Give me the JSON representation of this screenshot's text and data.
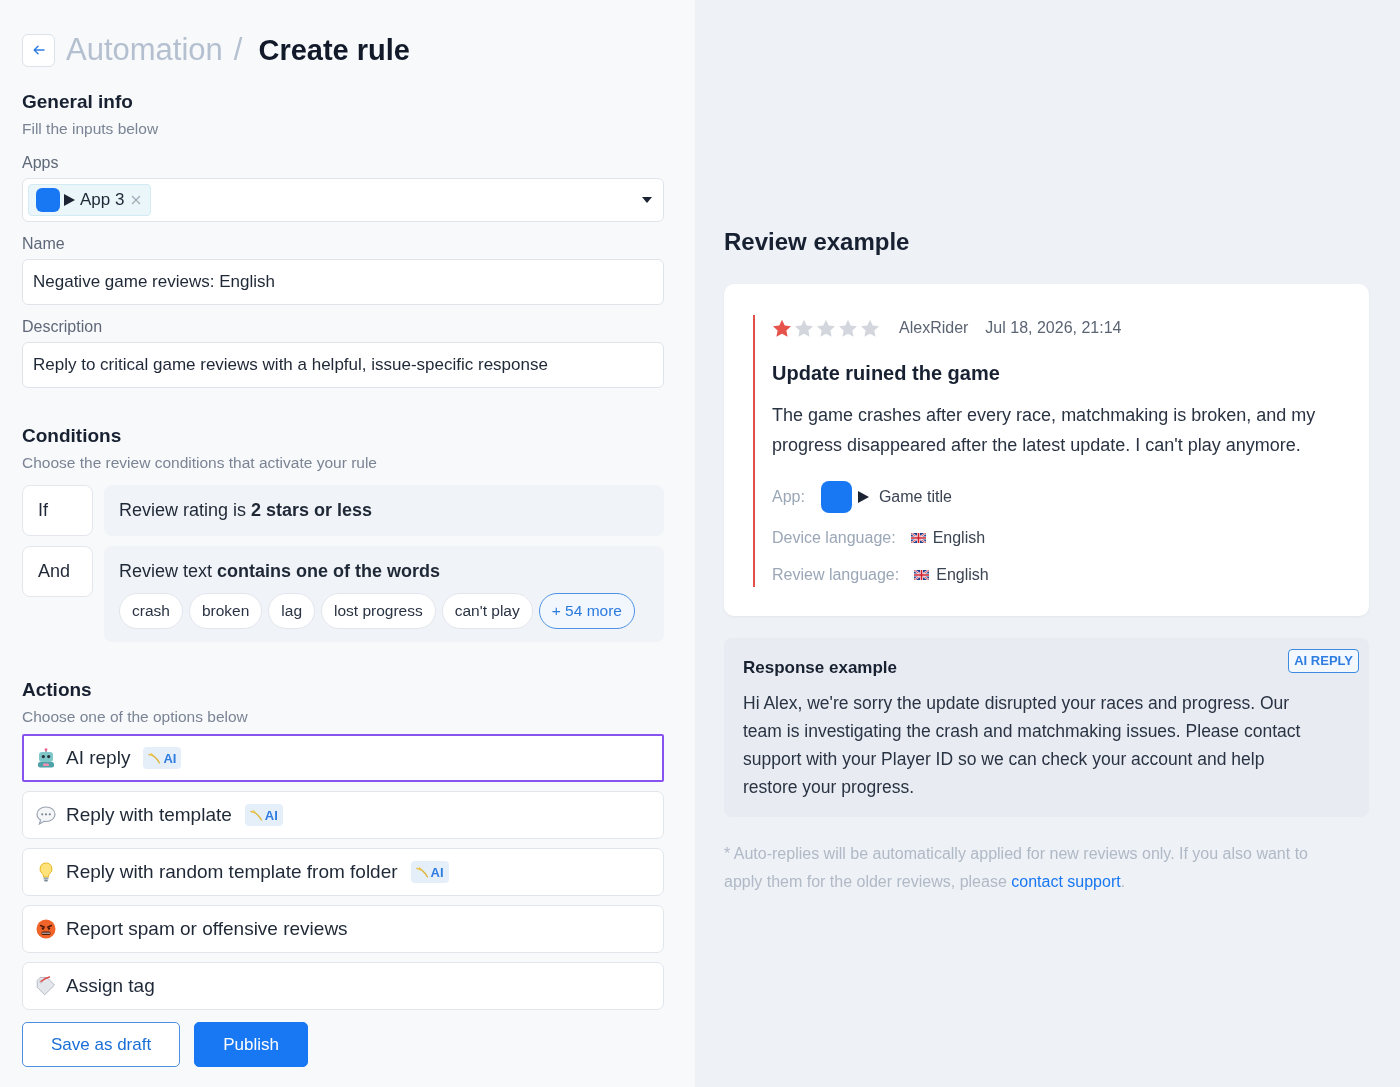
{
  "header": {
    "breadcrumb": [
      {
        "label": "Automation",
        "current": false
      },
      {
        "label": "Create rule",
        "current": true
      }
    ],
    "separator": "/"
  },
  "general_info": {
    "title": "General info",
    "subtitle": "Fill the inputs below",
    "apps": {
      "label": "Apps",
      "chips": [
        {
          "label": "App 3"
        }
      ]
    },
    "name": {
      "label": "Name",
      "value": "Negative game reviews: English"
    },
    "description": {
      "label": "Description",
      "value": "Reply to critical game reviews with a helpful, issue-specific response"
    }
  },
  "conditions": {
    "title": "Conditions",
    "subtitle": "Choose the review conditions that activate your rule",
    "rows": [
      {
        "operator": "If",
        "text": "Review rating is **2 stars or less**"
      },
      {
        "operator": "And",
        "text": "Review text **contains one of the words**",
        "words": [
          "crash",
          "broken",
          "lag",
          "lost progress",
          "can't play"
        ],
        "more": "+ 54 more"
      }
    ]
  },
  "actions": {
    "title": "Actions",
    "subtitle": "Choose one of the options below",
    "options": [
      {
        "kind": "ai",
        "label": "AI reply",
        "badge": "AI",
        "selected": true
      },
      {
        "kind": "template",
        "label": "Reply with template",
        "badge": "AI",
        "selected": false
      },
      {
        "kind": "folder",
        "label": "Reply with random template from folder",
        "badge": "AI",
        "selected": false
      },
      {
        "kind": "spam",
        "label": "Report spam or offensive reviews",
        "selected": false
      },
      {
        "kind": "tag",
        "label": "Assign tag",
        "selected": false
      }
    ]
  },
  "buttons": [
    {
      "label": "Save as draft",
      "kind": "secondary"
    },
    {
      "label": "Publish",
      "kind": "primary"
    }
  ],
  "review_example": {
    "title": "Review example",
    "stars": 1,
    "author": "AlexRider",
    "date": "Jul 18, 2026, 21:14",
    "headline": "Update ruined the game",
    "body": "The game crashes after every race, matchmaking is broken, and my progress disappeared after the latest update. I can't play anymore.",
    "details": [
      {
        "kind": "app",
        "label": "App:",
        "value": "Game title"
      },
      {
        "kind": "language",
        "label": "Device language:",
        "value": "English"
      },
      {
        "kind": "language",
        "label": "Review language:",
        "value": "English"
      }
    ]
  },
  "response_example": {
    "title": "Response example",
    "badge": "AI REPLY",
    "body": "Hi Alex, we're sorry the update disrupted your races and progress. Our team is investigating the crash and matchmaking issues. Please contact support with your Player ID so we can check your account and help restore your progress."
  },
  "footnote": {
    "text": "* Auto-replies will be automatically applied for new reviews only. If you also want to apply them for the older reviews, please",
    "link": "contact support",
    "end": "."
  }
}
